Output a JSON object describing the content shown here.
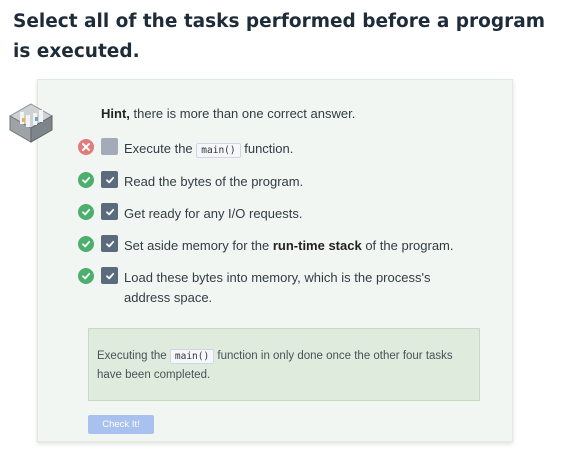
{
  "question": {
    "title": "Select all of the tasks performed before a program is executed."
  },
  "hint": {
    "bold": "Hint,",
    "text": " there is more than one correct answer."
  },
  "options": [
    {
      "status": "wrong",
      "checked": false,
      "pre": "Execute the ",
      "code": "main()",
      "post": " function."
    },
    {
      "status": "correct",
      "checked": true,
      "text": "Read the bytes of the program."
    },
    {
      "status": "correct",
      "checked": true,
      "text": "Get ready for any I/O requests."
    },
    {
      "status": "correct",
      "checked": true,
      "pre": "Set aside memory for the ",
      "bold": "run-time stack",
      "post": " of the program."
    },
    {
      "status": "correct",
      "checked": true,
      "line1": "Load these bytes into memory, which is the process's",
      "line2": "address space."
    }
  ],
  "feedback": {
    "pre": "Executing the ",
    "code": "main()",
    "post": " function in only done once the other four tasks have been completed."
  },
  "check_button": {
    "label": "Check It!"
  },
  "colors": {
    "correct": "#4caf6e",
    "wrong": "#e27b7b",
    "checked_box": "#5b6b7e",
    "button": "#a9c1ef"
  }
}
